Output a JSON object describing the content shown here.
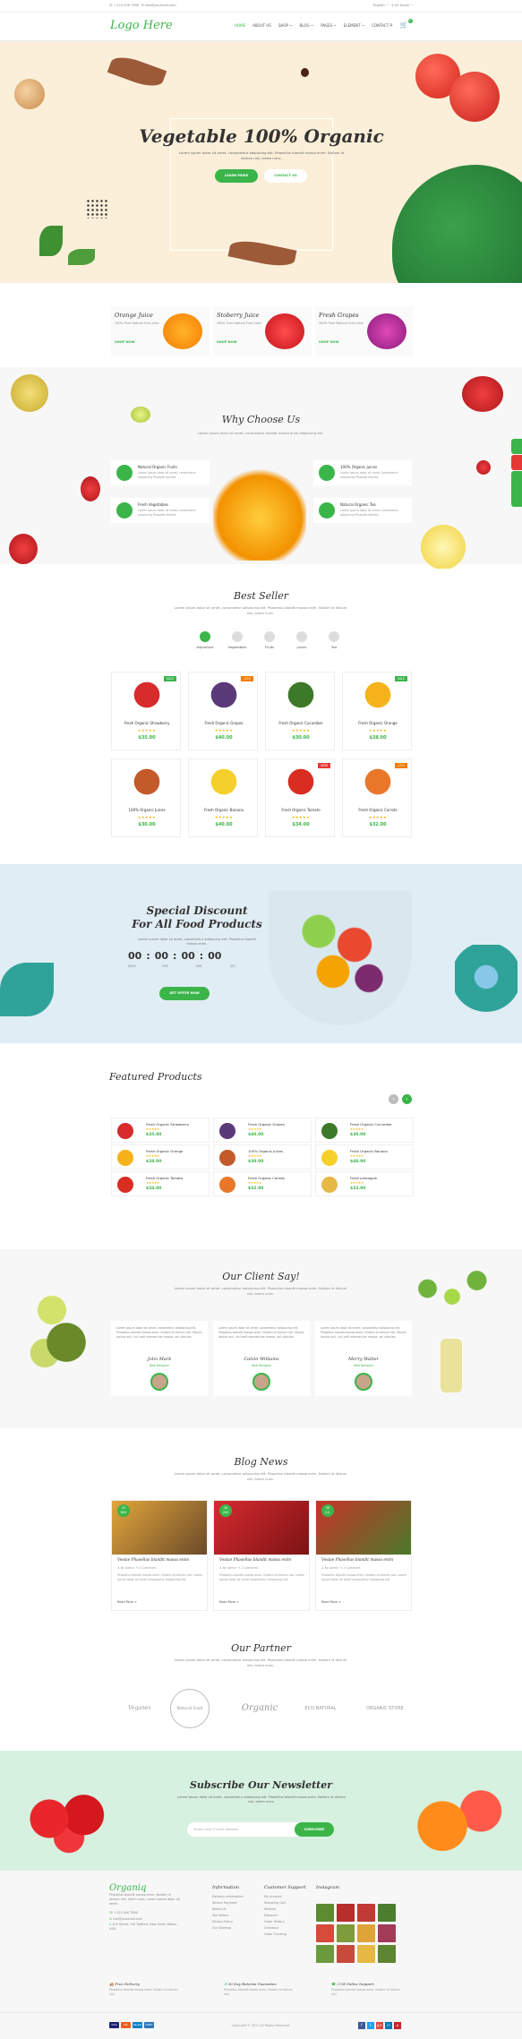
{
  "topbar": {
    "phone": "+123 456 7890",
    "email": "info@yourmail.com",
    "lang": "English ~",
    "currency": "$ US Dollar ~"
  },
  "header": {
    "logo": "Logo Here",
    "nav": [
      "HOME",
      "ABOUT US",
      "SHOP ~",
      "BLOG ~",
      "PAGES ~",
      "ELEMENT ~",
      "CONTACT"
    ],
    "cart_count": "0"
  },
  "hero": {
    "title": "Vegetable 100% Organic",
    "text": "Lorem ipsum dolor sit amet, consectetur adipiscing elit. Phasellus blandit massa enim. Nullam id dictum nisl, lorem nunc.",
    "btn_primary": "LEARN MORE",
    "btn_secondary": "CONTACT US"
  },
  "juices": [
    {
      "title": "Orange Juice",
      "desc": "100% Pure Natural Fruit Juice",
      "link": "SHOP NOW"
    },
    {
      "title": "Stoberry Juice",
      "desc": "100% Pure Natural Fruit Juice",
      "link": "SHOP NOW"
    },
    {
      "title": "Fresh Grapes",
      "desc": "100% Pure Natural Fruit Juice",
      "link": "SHOP NOW"
    }
  ],
  "why": {
    "title": "Why Choose Us",
    "sub": "Lorem ipsum dolor sit amet, consectetur blandit massa enim adipiscing elit.",
    "features": [
      {
        "title": "Natural Organic Fruits",
        "desc": "Lorem ipsum dolor sit amet, consectetur adipiscing Phasella blandit."
      },
      {
        "title": "Fresh Vegetables",
        "desc": "Lorem ipsum dolor sit amet, consectetur adipiscing Phasella blandit."
      },
      {
        "title": "100% Organic Juices",
        "desc": "Lorem ipsum dolor sit amet, consectetur adipiscing Phasella blandit."
      },
      {
        "title": "Natural Organic Tea",
        "desc": "Lorem ipsum dolor sit amet, consectetur adipiscing Phasella blandit."
      }
    ]
  },
  "bestseller": {
    "title": "Best Seller",
    "sub": "Lorem ipsum dolor sit amet, consectetur adipiscing elit. Phasellus blandit massa enim. Nullam id dictum nisl, lorem nunc.",
    "tabs": [
      "Allproduct",
      "Vegetables",
      "Fruits",
      "Juices",
      "Tea"
    ],
    "stars": "★★★★★",
    "products": [
      {
        "name": "Fresh Organic Strawberry",
        "price": "$35.00",
        "badge": "SALE"
      },
      {
        "name": "Fresh Organic Grapes",
        "price": "$40.00",
        "badge": "-10%"
      },
      {
        "name": "Fresh Organic Cucumber",
        "price": "$30.00",
        "badge": ""
      },
      {
        "name": "Fresh Organic Orange",
        "price": "$38.00",
        "badge": "SALE"
      },
      {
        "name": "100% Organic Juices",
        "price": "$30.00",
        "badge": ""
      },
      {
        "name": "Fresh Organic Banana",
        "price": "$40.00",
        "badge": ""
      },
      {
        "name": "Fresh Organic Tomato",
        "price": "$34.00",
        "badge": "NEW"
      },
      {
        "name": "Fresh Organic Carrots",
        "price": "$32.00",
        "badge": "-15%"
      }
    ]
  },
  "discount": {
    "title_line1": "Special Discount",
    "title_line2": "For All Food Products",
    "text": "Lorem ipsum dolor sit amet, consectetur adipiscing elit. Phasellus blandit massa enim.",
    "counter": [
      "00",
      "00",
      "00",
      "00"
    ],
    "labels": [
      "DAYS",
      "HRS",
      "MIN",
      "SEC"
    ],
    "btn": "GET OFFER NOW"
  },
  "featured": {
    "title": "Featured Products",
    "items": [
      {
        "name": "Fresh Organic Strawberry",
        "price": "$35.00"
      },
      {
        "name": "Fresh Organic Grapes",
        "price": "$40.00"
      },
      {
        "name": "Fresh Organic Cucumber",
        "price": "$30.00"
      },
      {
        "name": "Fresh Organic Orange",
        "price": "$38.00"
      },
      {
        "name": "100% Organic Juices",
        "price": "$30.00"
      },
      {
        "name": "Fresh Organic Banana",
        "price": "$40.00"
      },
      {
        "name": "Fresh Organic Tomato",
        "price": "$34.00"
      },
      {
        "name": "Fresh Organic Carrots",
        "price": "$32.00"
      },
      {
        "name": "Fresh pineapple",
        "price": "$33.00"
      }
    ]
  },
  "testimonials": {
    "title": "Our Client Say!",
    "sub": "Lorem ipsum dolor sit amet, consectetur adipiscing elit. Phasellus blandit massa enim. Nullam id dictum nisl, lorem nunc.",
    "quote": "Lorem ipsum dolor sit amet, consectetur adipiscing elit. Phasellus blandit massa enim. Nullam id dictum nisl. Mauris lacinia orci, nisl velit elementum massa, vel ultricies.",
    "people": [
      {
        "name": "John Mark",
        "role": "Web Designer"
      },
      {
        "name": "Calvin Williams",
        "role": "Web Designer"
      },
      {
        "name": "Merry Walter",
        "role": "Web Designer"
      }
    ]
  },
  "blog": {
    "title": "Blog News",
    "sub": "Lorem ipsum dolor sit amet, consectetur adipiscing elit. Phasellus blandit massa enim. Nullam id dictum nisl, lorem nunc.",
    "posts": [
      {
        "day": "22",
        "month": "MAY",
        "title": "Vestae Phasellus blandit massa enim",
        "author": "By Admin",
        "comments": "4 Comment",
        "desc": "Phasellus blandit massa enim. Nullam id dictum nisl. Lorem ipsum dolor sit amet consectetur adipiscing elit.",
        "more": "Read More  >"
      },
      {
        "day": "28",
        "month": "JUN",
        "title": "Vestae Phasellus blandit massa enim",
        "author": "By Admin",
        "comments": "2 Comment",
        "desc": "Phasellus blandit massa enim. Nullam id dictum nisl. Lorem ipsum dolor sit amet consectetur adipiscing elit.",
        "more": "Read More  >"
      },
      {
        "day": "08",
        "month": "JUL",
        "title": "Vestae Phasellus blandit massa enim",
        "author": "By Admin",
        "comments": "3 Comment",
        "desc": "Phasellus blandit massa enim. Nullam id dictum nisl. Lorem ipsum dolor sit amet consectetur adipiscing elit.",
        "more": "Read More  >"
      }
    ]
  },
  "partners": {
    "title": "Our Partner",
    "sub": "Lorem ipsum dolor sit amet, consectetur adipiscing elit. Phasellus blandit massa enim. Nullam id dictum nisl, lorem nunc.",
    "logos": [
      "Veganex",
      "Natural Food",
      "Organic",
      "ECO NATURAL",
      "ORGANIC STORE"
    ]
  },
  "newsletter": {
    "title": "Subscribe Our Newsletter",
    "text": "Lorem ipsum dolor sit amet, consectetur adipiscing elit. Phasellus blandit massa enim. Nullam id dictum nisl, lorem nunc.",
    "placeholder": "Enter your E-mail Address",
    "btn": "SUBSCRIBE"
  },
  "footer": {
    "logo": "Organiq",
    "about": "Phasellus blandit massa enim. Nullam id dictum nisl, lorem nunc. Lorem ipsum dolor sit amet.",
    "phone": "+123 456 7890",
    "email": "info@yourmail.com",
    "address": "123 Street, Old Trafford, New South Wales, USA",
    "info_title": "Information",
    "info": [
      "Delivery Information",
      "Secure Payment",
      "About Us",
      "Top Sellers",
      "Privacy Policy",
      "Our Sitemap"
    ],
    "support_title": "Customer Support",
    "support": [
      "My Account",
      "Shopping Cart",
      "Wishlist",
      "Discount",
      "Order History",
      "Checkout",
      "Order Tracking"
    ],
    "insta_title": "Instagram",
    "services": [
      {
        "title": "Free Delivery",
        "desc": "Phasellus blandit massa enim. Nullam id dictum nisl."
      },
      {
        "title": "30 Day Returns Guarantee",
        "desc": "Phasellus blandit massa enim. Nullam id dictum nisl."
      },
      {
        "title": "27/4 Online Support",
        "desc": "Phasellus blandit massa enim. Nullam id dictum nisl."
      }
    ],
    "payments": [
      "VISA",
      "MC",
      "PayPal",
      "AMEX"
    ],
    "copyright": "Copyright © 2021 All Rights Reserved.",
    "social": [
      "f",
      "t",
      "g+",
      "in",
      "p"
    ]
  },
  "colors": {
    "brand": "#3bb54a",
    "hero_bg": "#fbefd9",
    "discount_bg": "#e1edf4",
    "newsletter_bg": "#d7f1e1",
    "star": "#f5b301"
  }
}
